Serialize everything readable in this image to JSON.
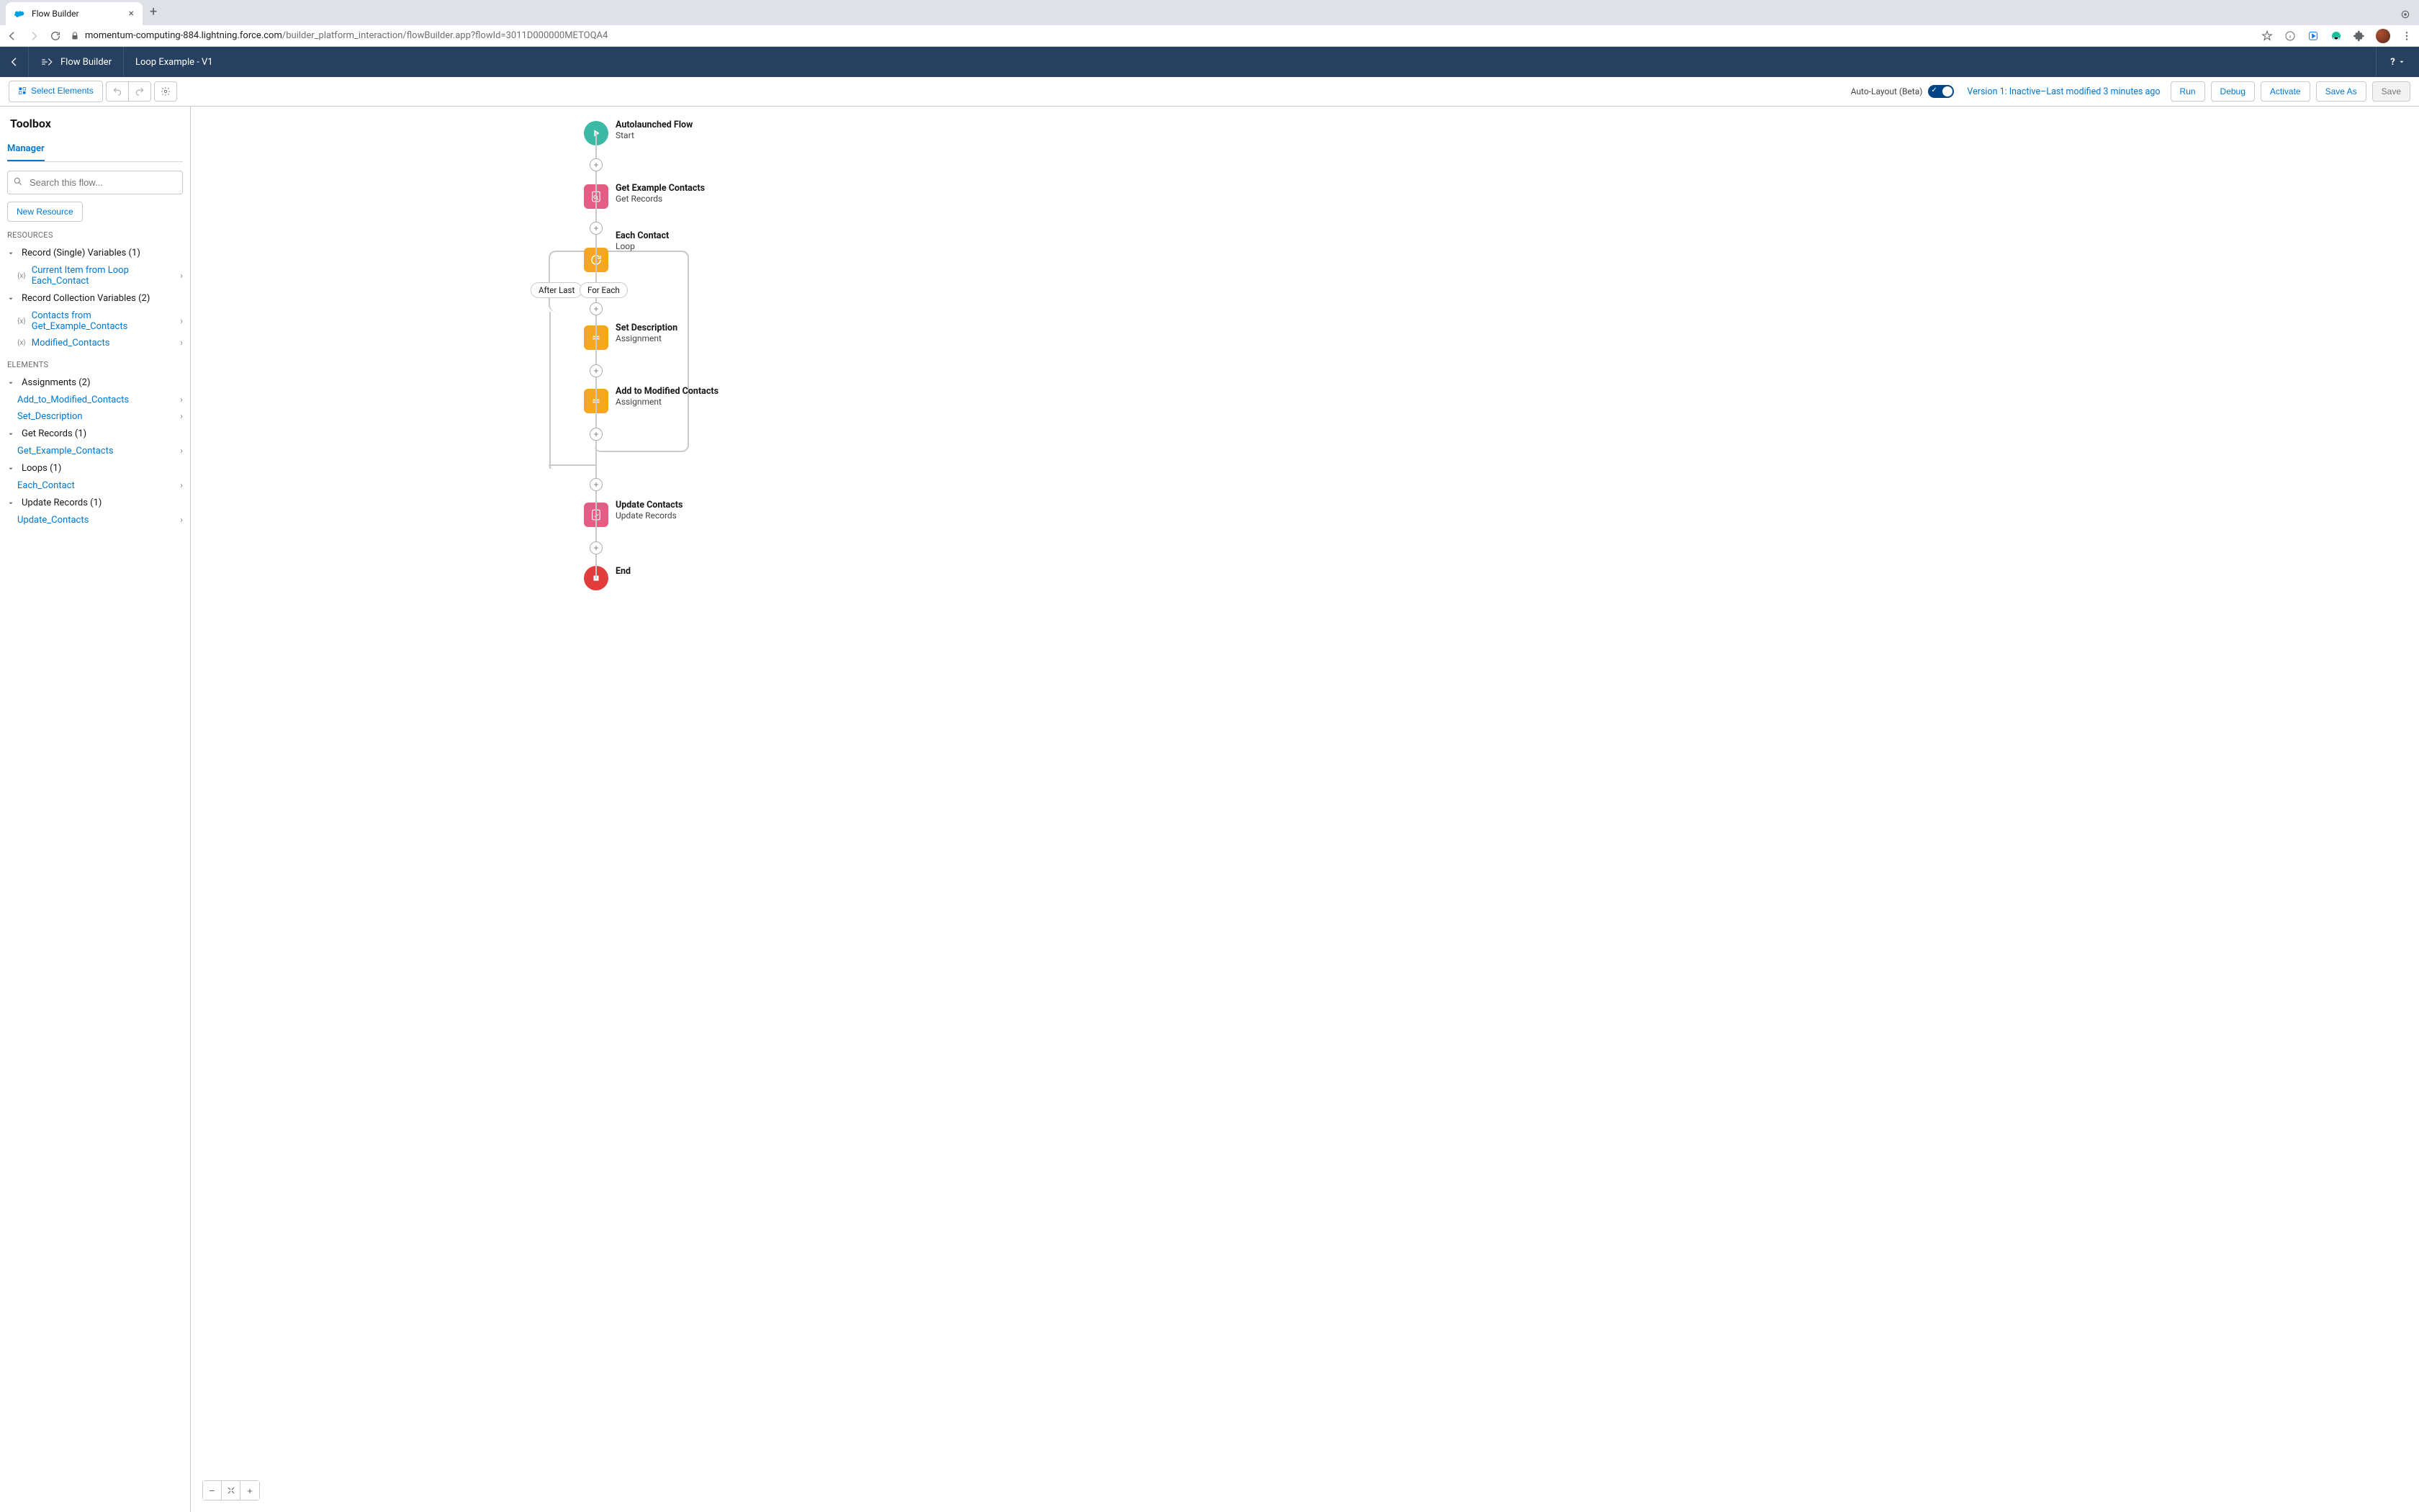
{
  "browser": {
    "tab_title": "Flow Builder",
    "url_host": "momentum-computing-884.lightning.force.com",
    "url_path": "/builder_platform_interaction/flowBuilder.app?flowId=3011D000000METOQA4"
  },
  "header": {
    "app_name": "Flow Builder",
    "flow_name": "Loop Example - V1",
    "help_label": "?"
  },
  "toolbar": {
    "select_elements": "Select Elements",
    "auto_layout_label": "Auto-Layout (Beta)",
    "version_status": "Version 1: Inactive–Last modified 3 minutes ago",
    "run": "Run",
    "debug": "Debug",
    "activate": "Activate",
    "save_as": "Save As",
    "save": "Save"
  },
  "sidebar": {
    "title": "Toolbox",
    "tab": "Manager",
    "search_placeholder": "Search this flow...",
    "new_resource": "New Resource",
    "resources_heading": "RESOURCES",
    "elements_heading": "ELEMENTS",
    "groups": {
      "rec_single": "Record (Single) Variables (1)",
      "rec_coll": "Record Collection Variables (2)",
      "assign": "Assignments (2)",
      "get": "Get Records (1)",
      "loops": "Loops (1)",
      "update": "Update Records (1)"
    },
    "leaves": {
      "cur_item": "Current Item from Loop Each_Contact",
      "contacts_from": "Contacts from Get_Example_Contacts",
      "mod_contacts": "Modified_Contacts",
      "add_to_mod": "Add_to_Modified_Contacts",
      "set_desc": "Set_Description",
      "get_example": "Get_Example_Contacts",
      "each_contact": "Each_Contact",
      "update_contacts": "Update_Contacts"
    }
  },
  "canvas": {
    "loop_labels": {
      "after_last": "After Last",
      "for_each": "For Each"
    },
    "nodes": {
      "start": {
        "title": "Autolaunched Flow",
        "subtitle": "Start"
      },
      "get": {
        "title": "Get Example Contacts",
        "subtitle": "Get Records"
      },
      "loop": {
        "title": "Each Contact",
        "subtitle": "Loop"
      },
      "set_desc": {
        "title": "Set Description",
        "subtitle": "Assignment"
      },
      "add_mod": {
        "title": "Add to Modified Contacts",
        "subtitle": "Assignment"
      },
      "update": {
        "title": "Update Contacts",
        "subtitle": "Update Records"
      },
      "end": {
        "title": "End",
        "subtitle": ""
      }
    }
  }
}
